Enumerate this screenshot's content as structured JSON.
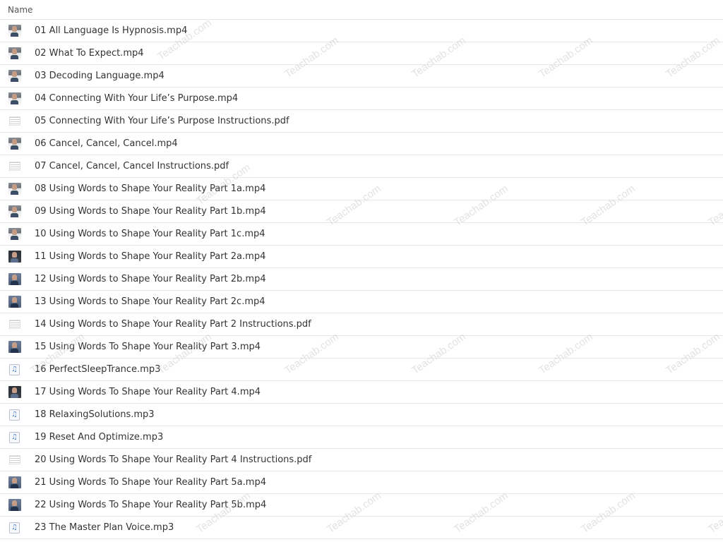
{
  "header": {
    "name_label": "Name"
  },
  "files": [
    {
      "name": "01 All Language Is Hypnosis.mp4",
      "kind": "video"
    },
    {
      "name": "02 What To Expect.mp4",
      "kind": "video"
    },
    {
      "name": "03 Decoding Language.mp4",
      "kind": "video"
    },
    {
      "name": "04 Connecting With Your Life’s Purpose.mp4",
      "kind": "video"
    },
    {
      "name": "05 Connecting With Your Life’s Purpose Instructions.pdf",
      "kind": "pdf"
    },
    {
      "name": "06 Cancel, Cancel, Cancel.mp4",
      "kind": "video"
    },
    {
      "name": "07 Cancel, Cancel, Cancel Instructions.pdf",
      "kind": "pdf"
    },
    {
      "name": "08 Using Words to Shape Your Reality Part 1a.mp4",
      "kind": "video"
    },
    {
      "name": "09 Using Words to Shape Your Reality Part 1b.mp4",
      "kind": "video"
    },
    {
      "name": "10 Using Words to Shape Your Reality Part 1c.mp4",
      "kind": "video"
    },
    {
      "name": "11 Using Words to Shape Your Reality Part 2a.mp4",
      "kind": "video-dark"
    },
    {
      "name": "12 Using Words to Shape Your Reality Part 2b.mp4",
      "kind": "video-blue"
    },
    {
      "name": "13 Using Words to Shape Your Reality Part 2c.mp4",
      "kind": "video-blue"
    },
    {
      "name": "14 Using Words to Shape Your Reality Part 2 Instructions.pdf",
      "kind": "pdf"
    },
    {
      "name": "15 Using Words To Shape Your Reality Part 3.mp4",
      "kind": "video-blue"
    },
    {
      "name": "16 PerfectSleepTrance.mp3",
      "kind": "audio"
    },
    {
      "name": "17 Using Words To Shape Your Reality Part 4.mp4",
      "kind": "video-dark"
    },
    {
      "name": "18 RelaxingSolutions.mp3",
      "kind": "audio"
    },
    {
      "name": "19 Reset And Optimize.mp3",
      "kind": "audio"
    },
    {
      "name": "20 Using Words To Shape Your Reality Part 4 Instructions.pdf",
      "kind": "pdf"
    },
    {
      "name": "21 Using Words To Shape Your Reality Part 5a.mp4",
      "kind": "video-blue"
    },
    {
      "name": "22 Using Words To Shape Your Reality Part 5b.mp4",
      "kind": "video-blue"
    },
    {
      "name": "23 The Master Plan Voice.mp3",
      "kind": "audio"
    }
  ],
  "watermark": "Teachab.com",
  "icons": {
    "video": "video-thumbnail-icon",
    "pdf": "pdf-file-icon",
    "audio": "audio-file-icon",
    "audio_glyph": "♫"
  }
}
